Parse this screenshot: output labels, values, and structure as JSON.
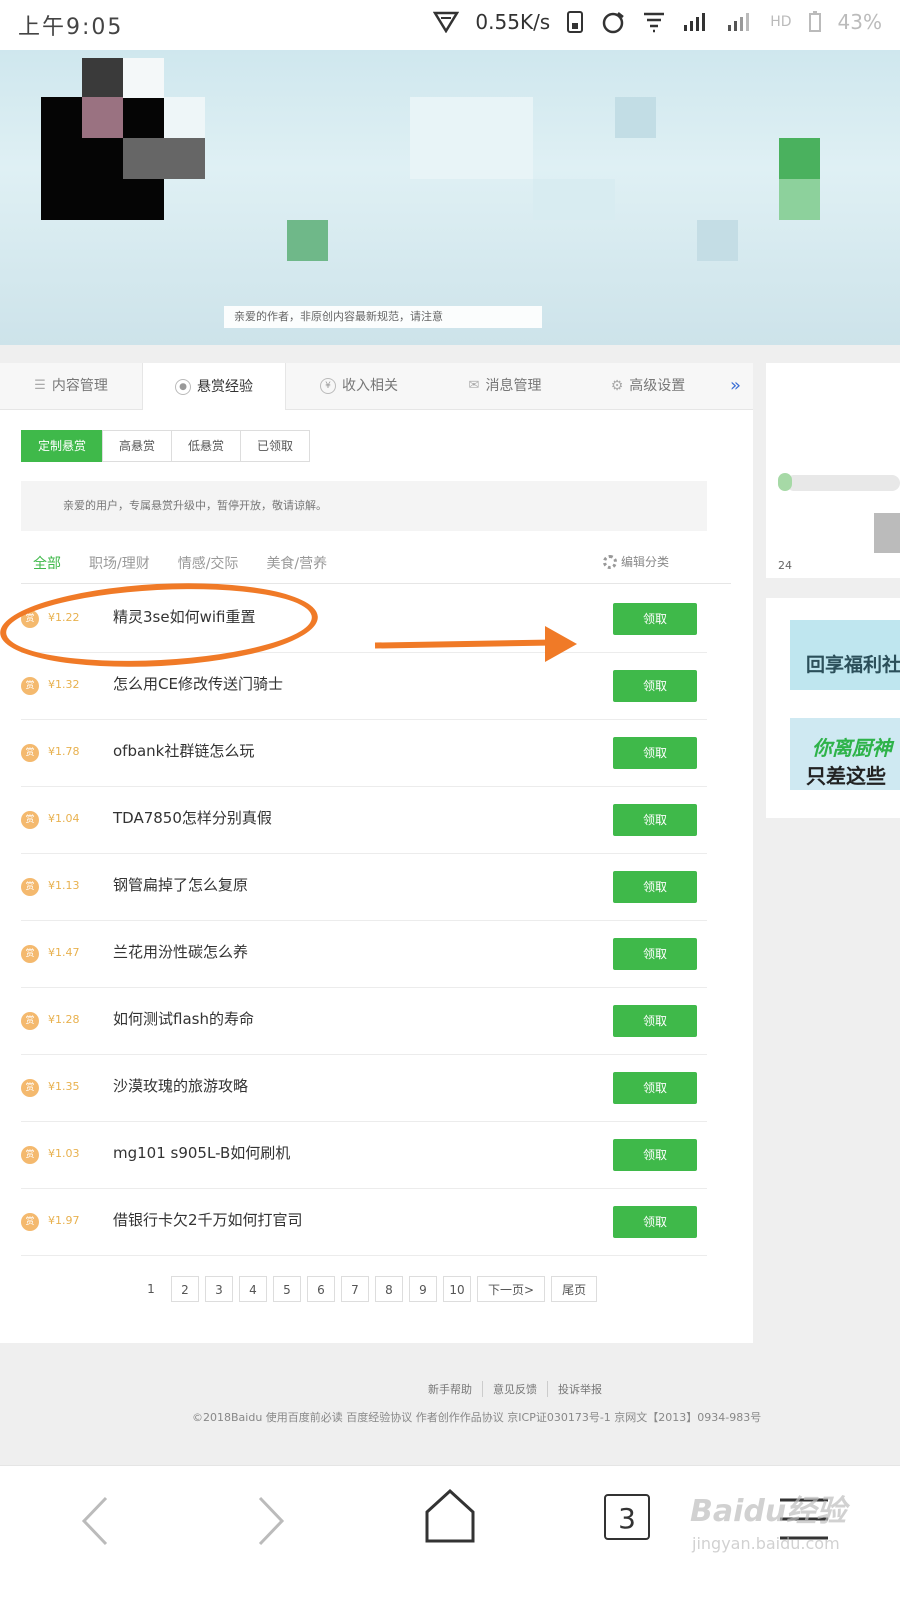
{
  "status_bar": {
    "time": "上午9:05",
    "speed": "0.55K/s",
    "battery": "43%"
  },
  "banner": {
    "notice": "亲爱的作者，非原创内容最新规范，请注意"
  },
  "tabs": [
    {
      "label": "内容管理",
      "icon": "list-icon"
    },
    {
      "label": "悬赏经验",
      "icon": "coin-icon",
      "active": true
    },
    {
      "label": "收入相关",
      "icon": "yen-icon"
    },
    {
      "label": "消息管理",
      "icon": "mail-icon"
    },
    {
      "label": "高级设置",
      "icon": "gear-icon"
    },
    {
      "label": "»",
      "icon": "more-icon"
    }
  ],
  "subtabs": [
    {
      "label": "定制悬赏",
      "active": true
    },
    {
      "label": "高悬赏"
    },
    {
      "label": "低悬赏"
    },
    {
      "label": "已领取"
    }
  ],
  "info_text": "亲爱的用户，专属悬赏升级中，暂停开放，敬请谅解。",
  "categories": [
    "全部",
    "职场/理财",
    "情感/交际",
    "美食/营养"
  ],
  "edit_category": "编辑分类",
  "coin_label": "赏",
  "claim_label": "领取",
  "questions": [
    {
      "reward": "¥1.22",
      "title": "精灵3se如何wifi重置"
    },
    {
      "reward": "¥1.32",
      "title": "怎么用CE修改传送门骑士"
    },
    {
      "reward": "¥1.78",
      "title": "ofbank社群链怎么玩"
    },
    {
      "reward": "¥1.04",
      "title": "TDA7850怎样分别真假"
    },
    {
      "reward": "¥1.13",
      "title": "钢管扁掉了怎么复原"
    },
    {
      "reward": "¥1.47",
      "title": "兰花用汾性碳怎么养"
    },
    {
      "reward": "¥1.28",
      "title": "如何测试flash的寿命"
    },
    {
      "reward": "¥1.35",
      "title": "沙漠玫瑰的旅游攻略"
    },
    {
      "reward": "¥1.03",
      "title": "mg101 s905L-B如何刷机"
    },
    {
      "reward": "¥1.97",
      "title": "借银行卡欠2千万如何打官司"
    }
  ],
  "pagination": [
    "1",
    "2",
    "3",
    "4",
    "5",
    "6",
    "7",
    "8",
    "9",
    "10",
    "下一页>",
    "尾页"
  ],
  "sidebar": {
    "number": "24",
    "promo1": "回享福利社",
    "promo2_line1": "你离厨神",
    "promo2_line2": "只差这些"
  },
  "footer": {
    "links": [
      "新手帮助",
      "意见反馈",
      "投诉举报"
    ],
    "copyright": "©2018Baidu  使用百度前必读  百度经验协议  作者创作作品协议  京ICP证030173号-1  京网文【2013】0934-983号"
  },
  "bottom_nav": {
    "tab_count": "3",
    "watermark": "Baidu经验",
    "watermark_url": "jingyan.baidu.com"
  },
  "colors": {
    "accent": "#3fb94a",
    "annotation": "#f07a27",
    "reward": "#e8b14f"
  }
}
